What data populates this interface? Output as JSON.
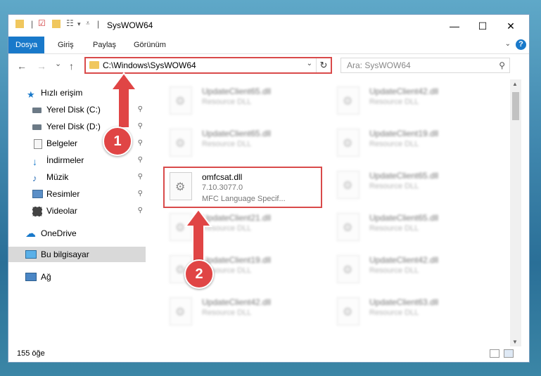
{
  "window": {
    "title": "SysWOW64",
    "controls": {
      "minimize": "—",
      "maximize": "☐",
      "close": "✕"
    }
  },
  "ribbon": {
    "tabs": [
      "Dosya",
      "Giriş",
      "Paylaş",
      "Görünüm"
    ],
    "active_tab": "Dosya",
    "help": "?"
  },
  "nav": {
    "back": "←",
    "forward": "→",
    "recent": "⌄",
    "up": "↑",
    "address": "C:\\Windows\\SysWOW64",
    "refresh": "↻",
    "search_placeholder": "Ara: SysWOW64"
  },
  "sidebar": {
    "items": [
      {
        "label": "Hızlı erişim",
        "icon": "star-icon"
      },
      {
        "label": "Yerel Disk (C:)",
        "icon": "drive-icon",
        "pinned": true
      },
      {
        "label": "Yerel Disk (D:)",
        "icon": "drive-icon",
        "pinned": true
      },
      {
        "label": "Belgeler",
        "icon": "documents-icon",
        "pinned": true
      },
      {
        "label": "İndirmeler",
        "icon": "download-icon",
        "pinned": true
      },
      {
        "label": "Müzik",
        "icon": "music-icon",
        "pinned": true
      },
      {
        "label": "Resimler",
        "icon": "pictures-icon",
        "pinned": true
      },
      {
        "label": "Videolar",
        "icon": "videos-icon",
        "pinned": true
      },
      {
        "label": "OneDrive",
        "icon": "cloud-icon"
      },
      {
        "label": "Bu bilgisayar",
        "icon": "computer-icon",
        "selected": true
      },
      {
        "label": "Ağ",
        "icon": "network-icon"
      }
    ],
    "pin_glyph": "📌"
  },
  "files": {
    "highlighted": {
      "name": "omfcsat.dll",
      "version": "7.10.3077.0",
      "description": "MFC Language Specif..."
    },
    "blurred_left": [
      {
        "name": "UpdateClient65.dll",
        "type": "Resource DLL"
      },
      {
        "name": "UpdateClient65.dll",
        "type": "Resource DLL"
      },
      {
        "name": "UpdateClient21.dll",
        "type": "Resource DLL"
      },
      {
        "name": "UpdateClient19.dll",
        "type": "Resource DLL"
      },
      {
        "name": "UpdateClient42.dll",
        "type": "Resource DLL"
      }
    ],
    "blurred_right": [
      {
        "name": "UpdateClient42.dll",
        "type": "Resource DLL"
      },
      {
        "name": "UpdateClient19.dll",
        "type": "Resource DLL"
      },
      {
        "name": "UpdateClient65.dll",
        "type": "Resource DLL"
      },
      {
        "name": "UpdateClient65.dll",
        "type": "Resource DLL"
      },
      {
        "name": "UpdateClient42.dll",
        "type": "Resource DLL"
      },
      {
        "name": "UpdateClient63.dll",
        "type": "Resource DLL"
      }
    ]
  },
  "status": {
    "count": "155 öğe"
  },
  "callouts": [
    "1",
    "2"
  ],
  "colors": {
    "accent": "#1979ca",
    "highlight": "#d94a4a",
    "folder": "#f0c75e"
  }
}
